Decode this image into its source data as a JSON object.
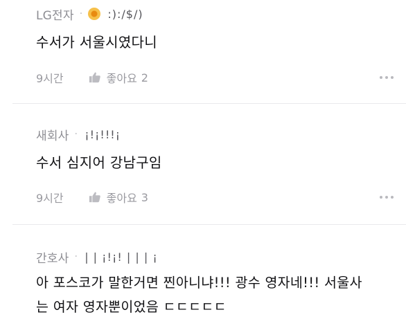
{
  "comments": [
    {
      "author": "LG전자",
      "author_extra": ":):/$/)",
      "has_badge": true,
      "body_lines": [
        "수서가 서울시였다니"
      ],
      "time": "9시간",
      "like_label": "좋아요",
      "like_count": "2"
    },
    {
      "author": "새회사",
      "author_extra": "¡!¡!!!¡",
      "has_badge": false,
      "body_lines": [
        "수서 심지어 강남구임"
      ],
      "time": "9시간",
      "like_label": "좋아요",
      "like_count": "3"
    },
    {
      "author": "간호사",
      "author_extra": "| | ¡!¡! | | | ¡",
      "has_badge": false,
      "body_lines": [
        "아 포스코가 말한거면 찐아니냐!!! 광수 영자네!!! 서울사",
        "는 여자 영자뿐이었음 ㄷㄷㄷㄷㄷ"
      ]
    }
  ],
  "separator_glyph": "·",
  "icons": {
    "badge": "sun-badge-icon",
    "like": "thumbs-up-icon",
    "more": "more-dots-icon"
  }
}
